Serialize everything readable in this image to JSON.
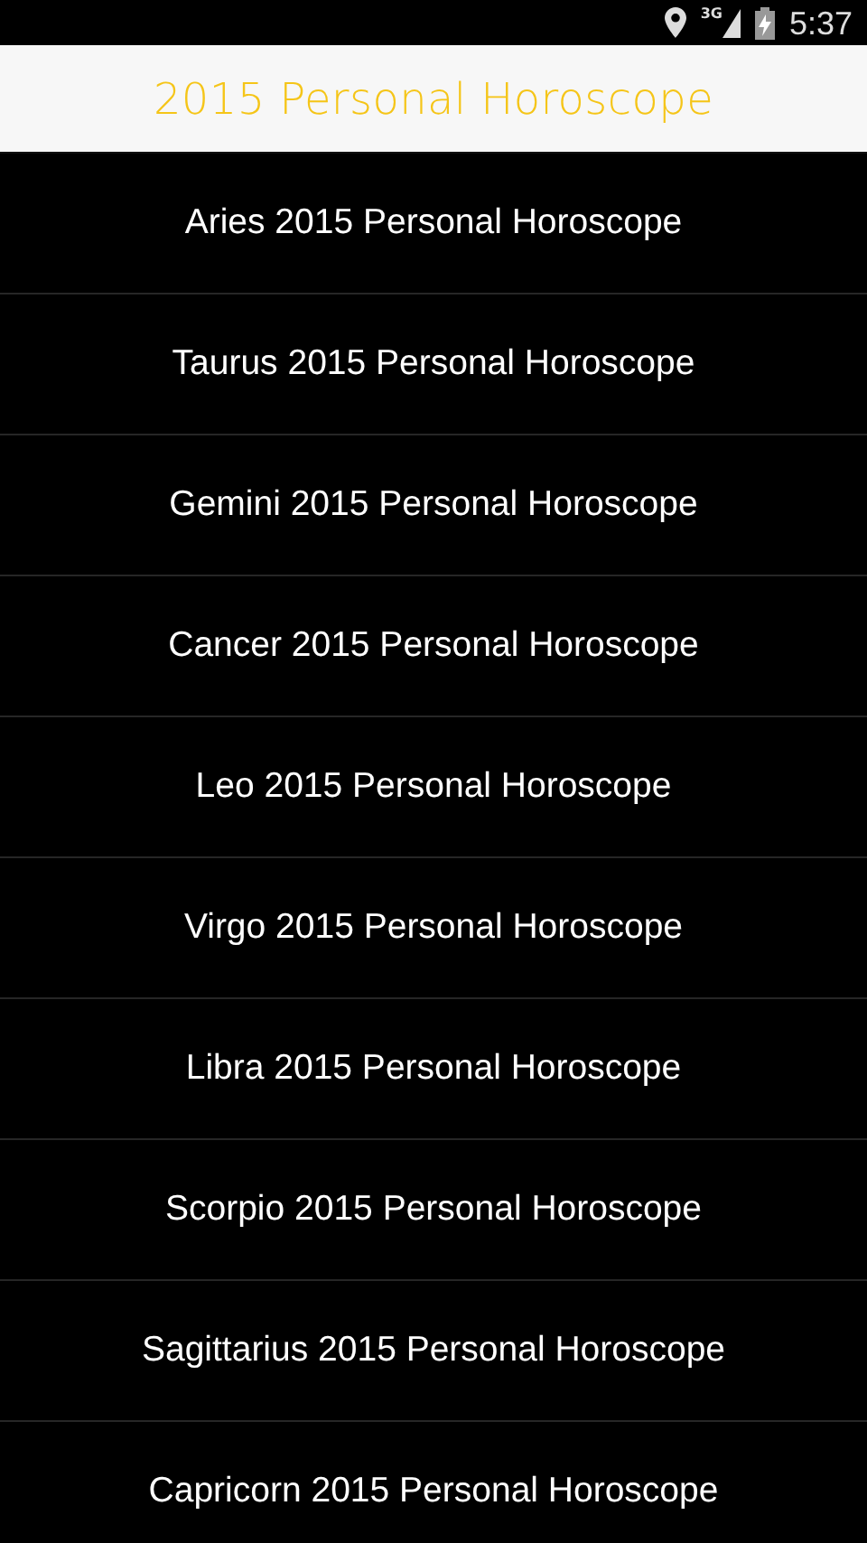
{
  "status_bar": {
    "time": "5:37",
    "network": "3G"
  },
  "header": {
    "title": "2015 Personal Horoscope"
  },
  "items": [
    {
      "label": "Aries 2015 Personal Horoscope"
    },
    {
      "label": "Taurus 2015 Personal Horoscope"
    },
    {
      "label": "Gemini 2015 Personal Horoscope"
    },
    {
      "label": "Cancer 2015 Personal Horoscope"
    },
    {
      "label": "Leo 2015 Personal Horoscope"
    },
    {
      "label": "Virgo 2015 Personal Horoscope"
    },
    {
      "label": "Libra 2015 Personal Horoscope"
    },
    {
      "label": "Scorpio 2015 Personal Horoscope"
    },
    {
      "label": "Sagittarius 2015 Personal Horoscope"
    },
    {
      "label": "Capricorn 2015 Personal Horoscope"
    }
  ]
}
